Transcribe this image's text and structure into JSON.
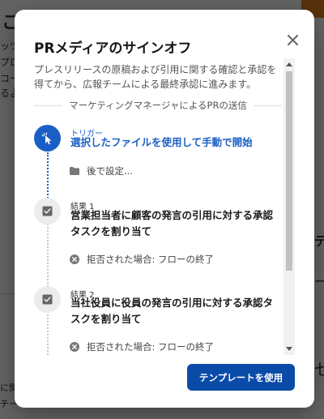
{
  "modal": {
    "title": "PRメディアのサインオフ",
    "description": "プレスリリースの原稿および引用に関する確認と承認を得てから、広報チームによる最終承認に進みます。",
    "section_title": "マーケティングマネージャによるPRの送信",
    "trigger": {
      "label": "トリガー",
      "title": "選択したファイルを使用して手動で開始",
      "sub": "後で設定..."
    },
    "steps": [
      {
        "label": "結果 1",
        "title": "営業担当者に顧客の発言の引用に対する承認タスクを割り当て",
        "sub": "拒否された場合: フローの終了"
      },
      {
        "label": "結果 2",
        "title": "当社役員に役員の発言の引用に対する承認タスクを割り当て",
        "sub": "拒否された場合: フローの終了"
      }
    ],
    "primary_button": "テンプレートを使用",
    "close_icon": "close-icon"
  },
  "background": {
    "fragments": [
      "こ",
      "ッツ",
      "プロ",
      "コー",
      "るよ",
      "に関",
      "チー",
      "ー",
      "セ",
      "デ"
    ]
  },
  "colors": {
    "accent": "#1b5fc6",
    "button": "#0a4ba8",
    "overlay": "rgba(0,0,0,0.6)"
  }
}
